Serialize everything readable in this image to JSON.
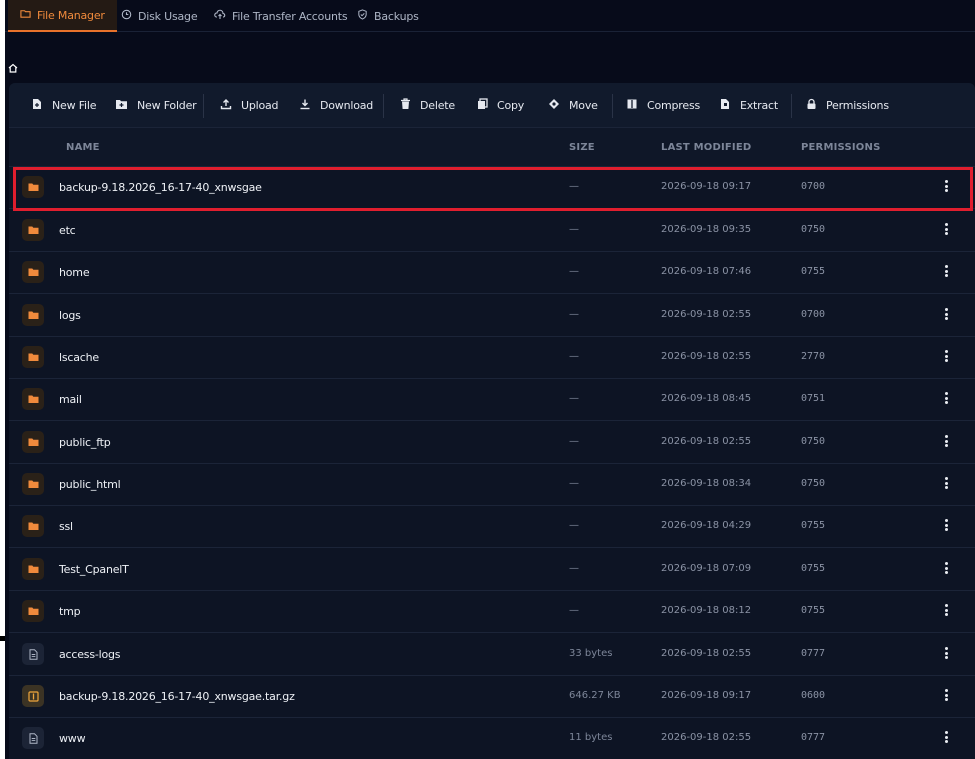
{
  "tabs": [
    {
      "label": "File Manager",
      "icon": "folder-open-icon",
      "active": true
    },
    {
      "label": "Disk Usage",
      "icon": "clock-icon",
      "active": false
    },
    {
      "label": "File Transfer Accounts",
      "icon": "cloud-upload-icon",
      "active": false
    },
    {
      "label": "Backups",
      "icon": "shield-check-icon",
      "active": false
    }
  ],
  "breadcrumb": {
    "icon": "home-icon"
  },
  "toolbar": [
    {
      "label": "New File",
      "icon": "file-plus-icon"
    },
    {
      "label": "New Folder",
      "icon": "folder-plus-icon"
    },
    {
      "label": "Upload",
      "icon": "upload-icon"
    },
    {
      "label": "Download",
      "icon": "download-icon"
    },
    {
      "label": "Delete",
      "icon": "trash-icon"
    },
    {
      "label": "Copy",
      "icon": "copy-icon"
    },
    {
      "label": "Move",
      "icon": "move-icon"
    },
    {
      "label": "Compress",
      "icon": "compress-icon"
    },
    {
      "label": "Extract",
      "icon": "extract-icon"
    },
    {
      "label": "Permissions",
      "icon": "lock-icon"
    }
  ],
  "columns": {
    "name": "NAME",
    "size": "SIZE",
    "modified": "LAST MODIFIED",
    "permissions": "PERMISSIONS"
  },
  "files": [
    {
      "name": "backup-9.18.2026_16-17-40_xnwsgae",
      "type": "folder",
      "size": "—",
      "modified": "2026-09-18 09:17",
      "permissions": "0700",
      "highlighted": true
    },
    {
      "name": "etc",
      "type": "folder",
      "size": "—",
      "modified": "2026-09-18 09:35",
      "permissions": "0750"
    },
    {
      "name": "home",
      "type": "folder",
      "size": "—",
      "modified": "2026-09-18 07:46",
      "permissions": "0755"
    },
    {
      "name": "logs",
      "type": "folder",
      "size": "—",
      "modified": "2026-09-18 02:55",
      "permissions": "0700"
    },
    {
      "name": "lscache",
      "type": "folder",
      "size": "—",
      "modified": "2026-09-18 02:55",
      "permissions": "2770"
    },
    {
      "name": "mail",
      "type": "folder",
      "size": "—",
      "modified": "2026-09-18 08:45",
      "permissions": "0751"
    },
    {
      "name": "public_ftp",
      "type": "folder",
      "size": "—",
      "modified": "2026-09-18 02:55",
      "permissions": "0750"
    },
    {
      "name": "public_html",
      "type": "folder",
      "size": "—",
      "modified": "2026-09-18 08:34",
      "permissions": "0750"
    },
    {
      "name": "ssl",
      "type": "folder",
      "size": "—",
      "modified": "2026-09-18 04:29",
      "permissions": "0755"
    },
    {
      "name": "Test_CpanelT",
      "type": "folder",
      "size": "—",
      "modified": "2026-09-18 07:09",
      "permissions": "0755"
    },
    {
      "name": "tmp",
      "type": "folder",
      "size": "—",
      "modified": "2026-09-18 08:12",
      "permissions": "0755"
    },
    {
      "name": "access-logs",
      "type": "file",
      "size": "33 bytes",
      "modified": "2026-09-18 02:55",
      "permissions": "0777"
    },
    {
      "name": "backup-9.18.2026_16-17-40_xnwsgae.tar.gz",
      "type": "archive",
      "size": "646.27 KB",
      "modified": "2026-09-18 09:17",
      "permissions": "0600"
    },
    {
      "name": "www",
      "type": "file",
      "size": "11 bytes",
      "modified": "2026-09-18 02:55",
      "permissions": "0777"
    }
  ],
  "colors": {
    "accent": "#e8722b",
    "highlight": "#e01e2e",
    "background": "#070b1a",
    "panel": "#0d1424"
  }
}
